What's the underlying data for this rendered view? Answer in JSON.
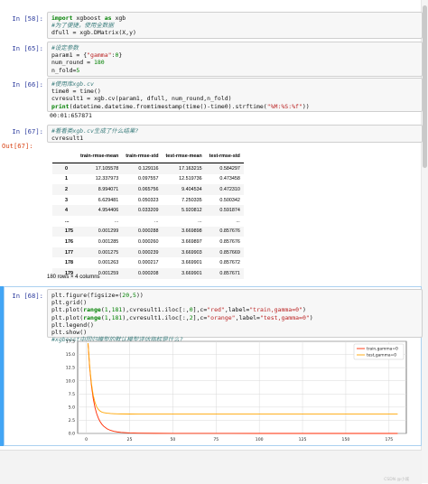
{
  "cells": [
    {
      "prompt": "In [58]:",
      "lines": [
        [
          [
            "k",
            "import"
          ],
          [
            "p",
            " xgboost "
          ],
          [
            "k",
            "as"
          ],
          [
            "p",
            " xgb"
          ]
        ],
        [
          [
            "c",
            "#为了便捷，使用全数据"
          ]
        ],
        [
          [
            "p",
            "dfull = xgb.DMatrix(X,y)"
          ]
        ]
      ]
    },
    {
      "prompt": "In [65]:",
      "lines": [
        [
          [
            "c",
            "#设定参数"
          ]
        ],
        [
          [
            "p",
            "param1 = {"
          ],
          [
            "s",
            "\"gamma\""
          ],
          [
            "p",
            ":"
          ],
          [
            "n",
            "0"
          ],
          [
            "p",
            "}"
          ]
        ],
        [
          [
            "p",
            "num_round = "
          ],
          [
            "n",
            "180"
          ]
        ],
        [
          [
            "p",
            "n_fold="
          ],
          [
            "n",
            "5"
          ]
        ]
      ]
    },
    {
      "prompt": "In [66]:",
      "lines": [
        [
          [
            "c",
            "#使用库xgb.cv"
          ]
        ],
        [
          [
            "p",
            "time0 = time()"
          ]
        ],
        [
          [
            "p",
            "cvresult1 = xgb.cv(param1, dfull, num_round,n_fold)"
          ]
        ],
        [
          [
            "b",
            "print"
          ],
          [
            "p",
            "(datetime.datetime.fromtimestamp(time()-time0).strftime("
          ],
          [
            "s",
            "\"%M:%S:%f\""
          ],
          [
            "p",
            "))"
          ]
        ]
      ],
      "stdout": "00:01:657871"
    },
    {
      "prompt": "In [67]:",
      "lines": [
        [
          [
            "c",
            "#看看类xgb.cv生成了什么结果?"
          ]
        ],
        [
          [
            "p",
            "cvresult1"
          ]
        ]
      ],
      "out_prompt": "Out[67]:"
    },
    {
      "prompt": "In [68]:",
      "lines": [
        [
          [
            "p",
            "plt.figure(figsize=("
          ],
          [
            "n",
            "20"
          ],
          [
            "p",
            ","
          ],
          [
            "n",
            "5"
          ],
          [
            "p",
            "))"
          ]
        ],
        [
          [
            "p",
            "plt.grid()"
          ]
        ],
        [
          [
            "p",
            "plt.plot("
          ],
          [
            "b",
            "range"
          ],
          [
            "p",
            "("
          ],
          [
            "n",
            "1"
          ],
          [
            "p",
            ","
          ],
          [
            "n",
            "181"
          ],
          [
            "p",
            "),cvresult1.iloc[:,"
          ],
          [
            "n",
            "0"
          ],
          [
            "p",
            "],c="
          ],
          [
            "s",
            "\"red\""
          ],
          [
            "p",
            ",label="
          ],
          [
            "s",
            "\"train,gamma=0\""
          ],
          [
            "p",
            ")"
          ]
        ],
        [
          [
            "p",
            "plt.plot("
          ],
          [
            "b",
            "range"
          ],
          [
            "p",
            "("
          ],
          [
            "n",
            "1"
          ],
          [
            "p",
            ","
          ],
          [
            "n",
            "181"
          ],
          [
            "p",
            "),cvresult1.iloc[:,"
          ],
          [
            "n",
            "2"
          ],
          [
            "p",
            "],c="
          ],
          [
            "s",
            "\"orange\""
          ],
          [
            "p",
            ",label="
          ],
          [
            "s",
            "\"test,gamma=0\""
          ],
          [
            "p",
            ")"
          ]
        ],
        [
          [
            "p",
            "plt.legend()"
          ]
        ],
        [
          [
            "p",
            "plt.show()"
          ]
        ],
        [
          [
            "c",
            "#xgboost中回归模型的默认模型评估指标是什么?"
          ]
        ]
      ]
    }
  ],
  "dataframe": {
    "columns": [
      "",
      "train-rmse-mean",
      "train-rmse-std",
      "test-rmse-mean",
      "test-rmse-std"
    ],
    "rows": [
      [
        "0",
        "17.105578",
        "0.129116",
        "17.163215",
        "0.584297"
      ],
      [
        "1",
        "12.337973",
        "0.097557",
        "12.519736",
        "0.473458"
      ],
      [
        "2",
        "8.994071",
        "0.065756",
        "9.404534",
        "0.472310"
      ],
      [
        "3",
        "6.629481",
        "0.050323",
        "7.250335",
        "0.500342"
      ],
      [
        "4",
        "4.954406",
        "0.033209",
        "5.920812",
        "0.591874"
      ],
      [
        "...",
        "...",
        "...",
        "...",
        "..."
      ],
      [
        "175",
        "0.001299",
        "0.000288",
        "3.669898",
        "0.857676"
      ],
      [
        "176",
        "0.001285",
        "0.000260",
        "3.669897",
        "0.857676"
      ],
      [
        "177",
        "0.001275",
        "0.000239",
        "3.669903",
        "0.857669"
      ],
      [
        "178",
        "0.001263",
        "0.000217",
        "3.669901",
        "0.857672"
      ],
      [
        "179",
        "0.001259",
        "0.000208",
        "3.669901",
        "0.857671"
      ]
    ],
    "shape_text": "180 rows × 4 columns"
  },
  "chart_data": {
    "type": "line",
    "title": "",
    "xlabel": "",
    "ylabel": "",
    "xlim": [
      -5,
      185
    ],
    "ylim": [
      0,
      17.5
    ],
    "xticks": [
      "0",
      "25",
      "50",
      "75",
      "100",
      "125",
      "150",
      "175"
    ],
    "yticks": [
      "0.0",
      "2.5",
      "5.0",
      "7.5",
      "10.0",
      "12.5",
      "15.0",
      "17.5"
    ],
    "grid": true,
    "legend_position": "top-right",
    "series": [
      {
        "name": "train,gamma=0",
        "color": "#ff2a00",
        "x": [
          1,
          2,
          3,
          4,
          5,
          6,
          7,
          8,
          9,
          10,
          12,
          14,
          16,
          18,
          20,
          25,
          30,
          40,
          50,
          60,
          80,
          100,
          120,
          140,
          160,
          180
        ],
        "values": [
          17.11,
          12.34,
          8.99,
          6.63,
          4.95,
          3.75,
          2.88,
          2.23,
          1.75,
          1.38,
          0.88,
          0.58,
          0.4,
          0.28,
          0.2,
          0.1,
          0.055,
          0.02,
          0.01,
          0.006,
          0.003,
          0.002,
          0.0016,
          0.0014,
          0.0013,
          0.0013
        ]
      },
      {
        "name": "test,gamma=0",
        "color": "#ffa500",
        "x": [
          1,
          2,
          3,
          4,
          5,
          6,
          7,
          8,
          9,
          10,
          12,
          14,
          16,
          18,
          20,
          25,
          30,
          40,
          50,
          60,
          80,
          100,
          120,
          140,
          160,
          180
        ],
        "values": [
          17.16,
          12.52,
          9.4,
          7.25,
          5.92,
          5.05,
          4.55,
          4.25,
          4.05,
          3.95,
          3.85,
          3.78,
          3.74,
          3.72,
          3.71,
          3.69,
          3.68,
          3.675,
          3.672,
          3.671,
          3.67,
          3.67,
          3.67,
          3.67,
          3.67,
          3.67
        ]
      }
    ]
  },
  "watermark": "CSDN @小城"
}
